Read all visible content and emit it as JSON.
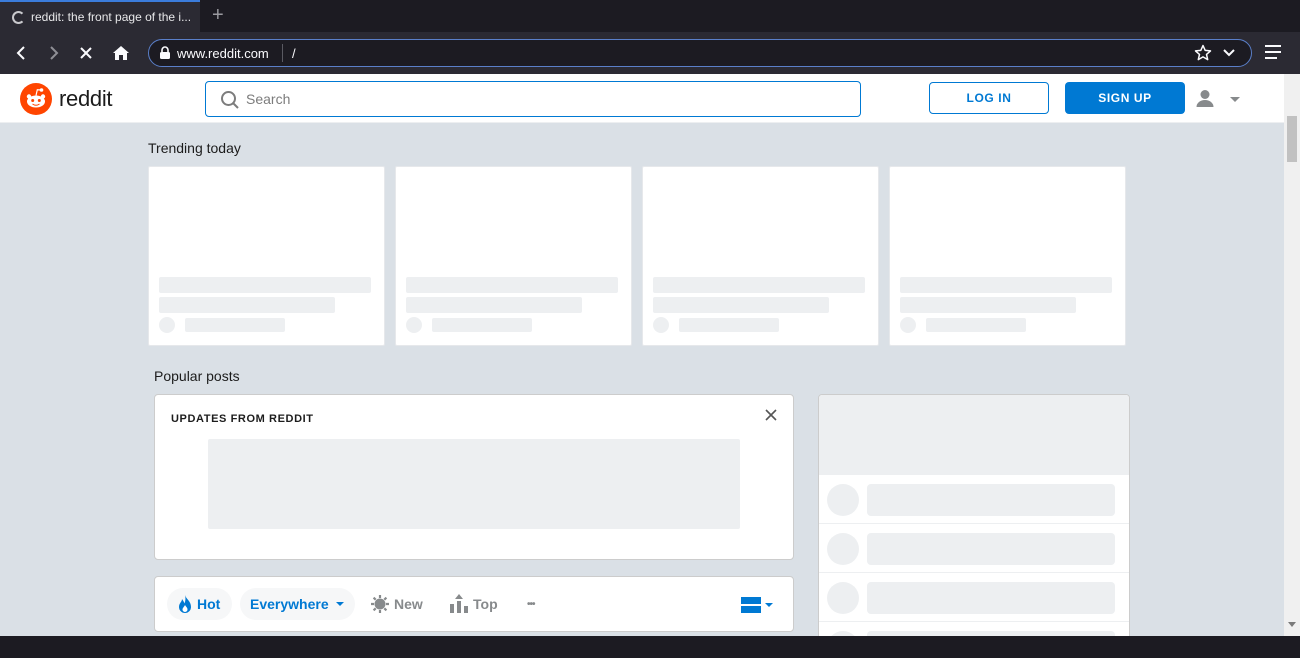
{
  "browser": {
    "tab_title": "reddit: the front page of the i...",
    "new_tab_glyph": "+",
    "url_host": "www.reddit.com",
    "url_path": "/"
  },
  "header": {
    "brand": "reddit",
    "search_placeholder": "Search",
    "login_label": "LOG IN",
    "signup_label": "SIGN UP"
  },
  "trending": {
    "title": "Trending today",
    "card_count": 4
  },
  "popular": {
    "title": "Popular posts",
    "updates_title": "UPDATES FROM REDDIT"
  },
  "sort": {
    "hot": "Hot",
    "everywhere": "Everywhere",
    "new": "New",
    "top": "Top",
    "more": "•••"
  },
  "colors": {
    "brand_orange": "#ff4500",
    "accent_blue": "#0079d3",
    "page_bg": "#dae0e6"
  },
  "icons": [
    "spinner-icon",
    "back-icon",
    "forward-icon",
    "stop-icon",
    "home-icon",
    "lock-icon",
    "star-icon",
    "chevron-down-icon",
    "hamburger-icon",
    "reddit-logo-icon",
    "search-icon",
    "user-icon",
    "close-icon",
    "flame-icon",
    "sun-icon",
    "top-icon",
    "card-view-icon"
  ]
}
